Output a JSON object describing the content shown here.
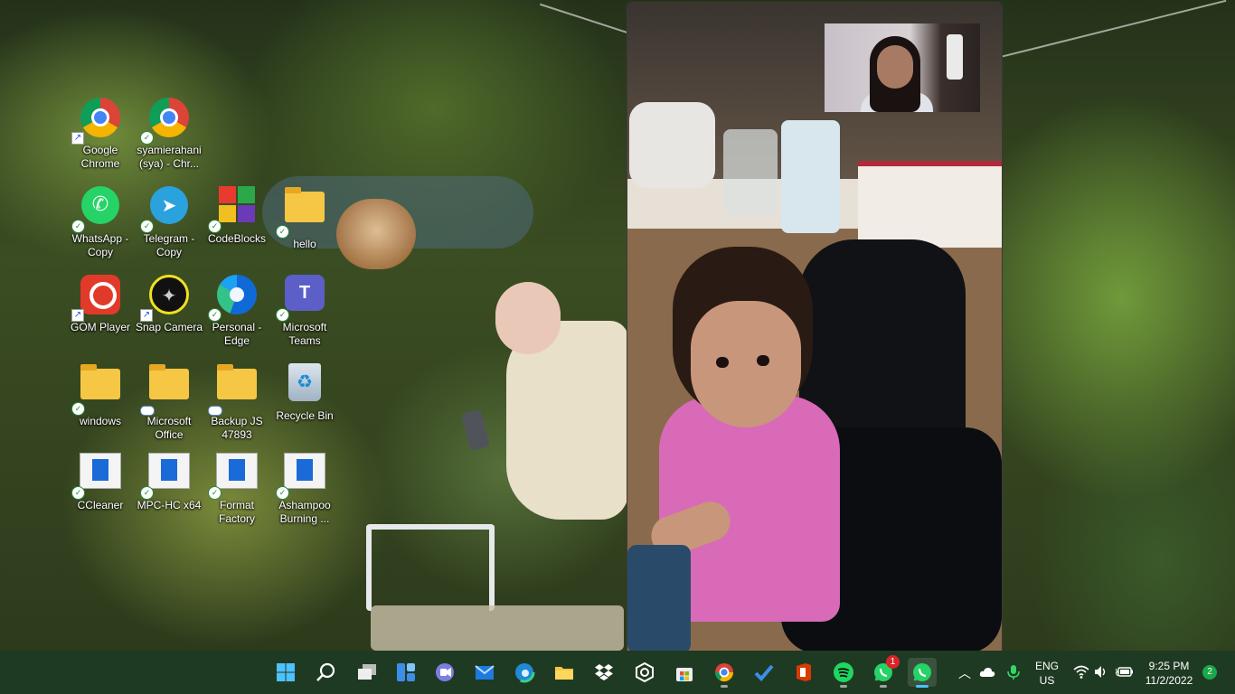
{
  "desktop_icons": [
    {
      "label": "Google Chrome",
      "icon": "chrome-icon",
      "overlay": "shortcut"
    },
    {
      "label": "syamierahani (sya) - Chr...",
      "icon": "chrome-profile-icon",
      "overlay": "synced"
    },
    {
      "label": "WhatsApp - Copy",
      "icon": "whatsapp-icon",
      "overlay": "synced"
    },
    {
      "label": "Telegram - Copy",
      "icon": "telegram-icon",
      "overlay": "synced"
    },
    {
      "label": "CodeBlocks",
      "icon": "codeblocks-icon",
      "overlay": "synced"
    },
    {
      "label": "hello",
      "icon": "folder-icon",
      "overlay": "synced"
    },
    {
      "label": "GOM Player",
      "icon": "gom-player-icon",
      "overlay": "shortcut"
    },
    {
      "label": "Snap Camera",
      "icon": "snap-camera-icon",
      "overlay": "shortcut"
    },
    {
      "label": "Personal - Edge",
      "icon": "edge-icon",
      "overlay": "synced"
    },
    {
      "label": "Microsoft Teams",
      "icon": "teams-icon",
      "overlay": "synced"
    },
    {
      "label": "windows",
      "icon": "folder-icon",
      "overlay": "synced"
    },
    {
      "label": "Microsoft Office",
      "icon": "folder-icon",
      "overlay": "cloud"
    },
    {
      "label": "Backup JS 47893",
      "icon": "folder-icon",
      "overlay": "cloud"
    },
    {
      "label": "Recycle Bin",
      "icon": "recycle-bin-icon",
      "overlay": ""
    },
    {
      "label": "CCleaner",
      "icon": "installer-icon",
      "overlay": "synced"
    },
    {
      "label": "MPC-HC x64",
      "icon": "installer-icon",
      "overlay": "synced"
    },
    {
      "label": "Format Factory",
      "icon": "installer-icon",
      "overlay": "synced"
    },
    {
      "label": "Ashampoo Burning ...",
      "icon": "installer-icon",
      "overlay": "synced"
    }
  ],
  "taskbar": {
    "apps": [
      {
        "name": "start-button",
        "icon": "windows-logo-icon"
      },
      {
        "name": "search-button",
        "icon": "search-icon"
      },
      {
        "name": "task-view-button",
        "icon": "task-view-icon"
      },
      {
        "name": "widgets-button",
        "icon": "widgets-icon"
      },
      {
        "name": "teams-chat-button",
        "icon": "teams-chat-icon"
      },
      {
        "name": "mail-app",
        "icon": "mail-icon"
      },
      {
        "name": "edge-app",
        "icon": "edge-icon"
      },
      {
        "name": "file-explorer-app",
        "icon": "folder-icon"
      },
      {
        "name": "dropbox-app",
        "icon": "dropbox-icon"
      },
      {
        "name": "snap-camera-app",
        "icon": "hexagon-icon"
      },
      {
        "name": "microsoft-store-app",
        "icon": "store-icon"
      },
      {
        "name": "chrome-app",
        "icon": "chrome-icon"
      },
      {
        "name": "todo-app",
        "icon": "checkmark-icon"
      },
      {
        "name": "office-app",
        "icon": "office-icon"
      },
      {
        "name": "spotify-app",
        "icon": "spotify-icon"
      },
      {
        "name": "whatsapp-app",
        "icon": "whatsapp-icon"
      },
      {
        "name": "whatsapp-call-app",
        "icon": "whatsapp-icon"
      }
    ],
    "whatsapp_badge": "1",
    "language_line1": "ENG",
    "language_line2": "US",
    "time": "9:25 PM",
    "date": "11/2/2022",
    "notification_count": "2"
  },
  "colors": {
    "taskbar": "#1f3a23",
    "accent_indicator": "#4cc2ff",
    "badge_red": "#d8242a",
    "notification_green": "#1aa84a"
  }
}
